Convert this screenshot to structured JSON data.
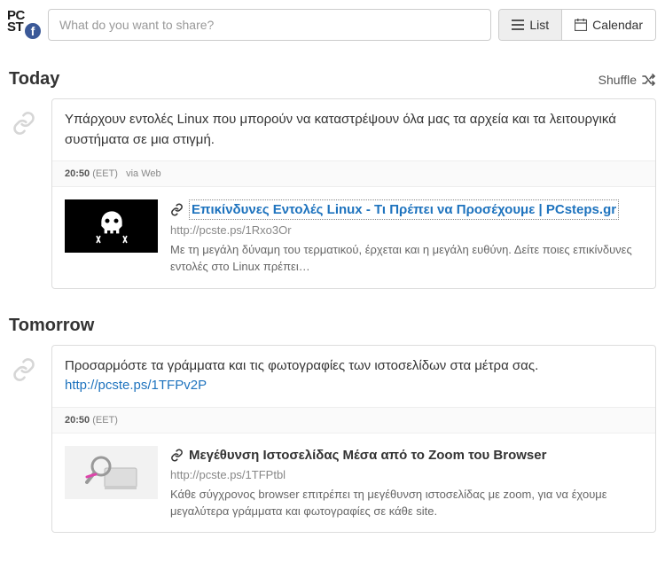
{
  "logo": {
    "line1": "PC",
    "line2": "ST",
    "badge": "f"
  },
  "share": {
    "placeholder": "What do you want to share?"
  },
  "view": {
    "list_label": "List",
    "calendar_label": "Calendar"
  },
  "shuffle_label": "Shuffle",
  "sections": {
    "today": {
      "title": "Today",
      "post": {
        "text": "Υπάρχουν εντολές Linux που μπορούν να καταστρέψουν όλα μας τα αρχεία και τα λειτουργικά συστήματα σε μια στιγμή.",
        "time": "20:50",
        "tz": "(EET)",
        "via": "via Web",
        "attachment": {
          "title": "Επικίνδυνες Εντολές Linux - Τι Πρέπει να Προσέχουμε | PCsteps.gr",
          "url": "http://pcste.ps/1Rxo3Or",
          "desc": "Με τη μεγάλη δύναμη του τερματικού, έρχεται και η μεγάλη ευθύνη. Δείτε ποιες επικίνδυνες εντολές στο Linux πρέπει…",
          "thumb_alt": "skull-and-crossbones"
        }
      }
    },
    "tomorrow": {
      "title": "Tomorrow",
      "post": {
        "text": "Προσαρμόστε τα γράμματα και τις φωτογραφίες των ιστοσελίδων στα μέτρα σας.",
        "text_link": "http://pcste.ps/1TFPv2P",
        "time": "20:50",
        "tz": "(EET)",
        "via": "",
        "attachment": {
          "title": "Μεγέθυνση Ιστοσελίδας Μέσα από το Zoom του Browser",
          "url": "http://pcste.ps/1TFPtbl",
          "desc": "Κάθε σύγχρονος browser επιτρέπει τη μεγέθυνση ιστοσελίδας με zoom, για να έχουμε μεγαλύτερα γράμματα και φωτογραφίες σε κάθε site.",
          "thumb_alt": "magnifying-glass-on-laptop"
        }
      }
    }
  }
}
